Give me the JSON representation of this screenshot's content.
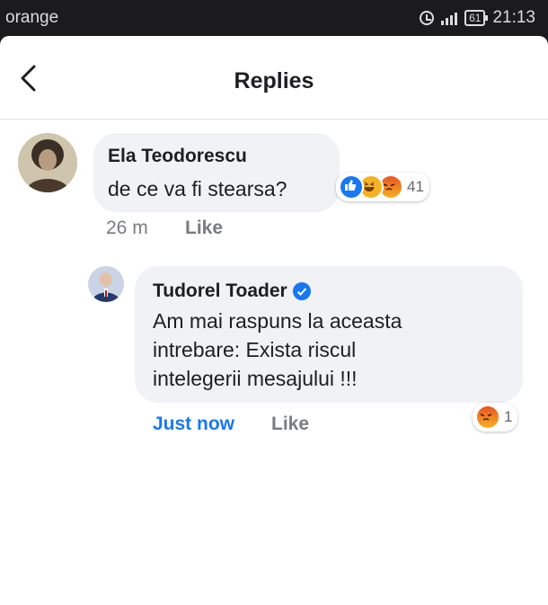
{
  "statusbar": {
    "carrier": "orange",
    "battery": "61",
    "time": "21:13"
  },
  "header": {
    "title": "Replies"
  },
  "comments": [
    {
      "author": "Ela Teodorescu",
      "text": "de ce va fi stearsa?",
      "time": "26 m",
      "like_label": "Like",
      "reaction_count": "41",
      "reactions": [
        "like",
        "haha",
        "angry"
      ]
    },
    {
      "author": "Tudorel Toader",
      "verified": true,
      "lines": [
        "Am mai raspuns la aceasta",
        "intrebare: Exista riscul",
        "intelegerii mesajului !!!"
      ],
      "time": "Just now",
      "like_label": "Like",
      "reaction_count": "1",
      "reactions": [
        "angry"
      ]
    }
  ],
  "colors": {
    "accent": "#1877f2",
    "bubble": "#f0f2f5",
    "meta": "#65676b"
  }
}
